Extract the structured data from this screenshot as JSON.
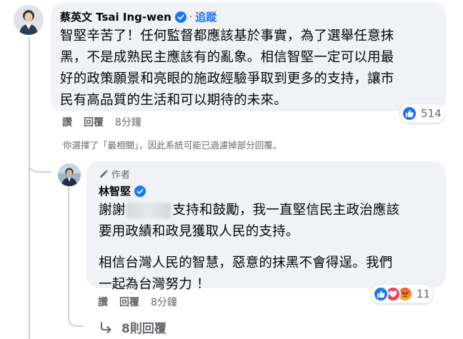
{
  "comment1": {
    "author": "蔡英文 Tsai Ing-wen",
    "follow_label": "追蹤",
    "separator": "·",
    "text_lines": [
      "智堅辛苦了！任何監督都應該基於事實，為了選舉任意抹",
      "黑，不是成熟民主應該有的亂象。相信智堅一定可以用最",
      "好的政策願景和亮眼的施政經驗爭取到更多的支持，讓市",
      "民有高品質的生活和可以期待的未來。"
    ],
    "actions": {
      "like": "讚",
      "reply": "回覆",
      "time": "8分鐘"
    },
    "reaction_count": "514"
  },
  "filter_notice": "你選擇了「最相關」，因此系統可能已過濾掉部分回覆。",
  "reply1": {
    "badge": "作者",
    "author": "林智堅",
    "text_lines": [
      {
        "before": "謝謝",
        "after": "支持和鼓勵，我一直堅信民主政治應該"
      },
      {
        "before": "要用政績和政見獲取人民的支持。",
        "after": ""
      }
    ],
    "text_lines2": [
      "相信台灣人民的智慧，惡意的抹黑不會得逞。我們",
      "一起為台灣努力 ！"
    ],
    "actions": {
      "like": "讚",
      "reply": "回覆",
      "time": "8分鐘"
    },
    "reaction_count": "11"
  },
  "more_replies": {
    "label": "8則回覆"
  },
  "colors": {
    "like": "#1877f2",
    "love": "#f33e58",
    "angry": "#e9710f",
    "bubble": "#f0f2f5",
    "secondary": "#65676b"
  },
  "icons": {
    "verified": "verified-badge-icon",
    "author_badge": "pencil-icon",
    "more_replies": "reply-arrow-icon"
  }
}
